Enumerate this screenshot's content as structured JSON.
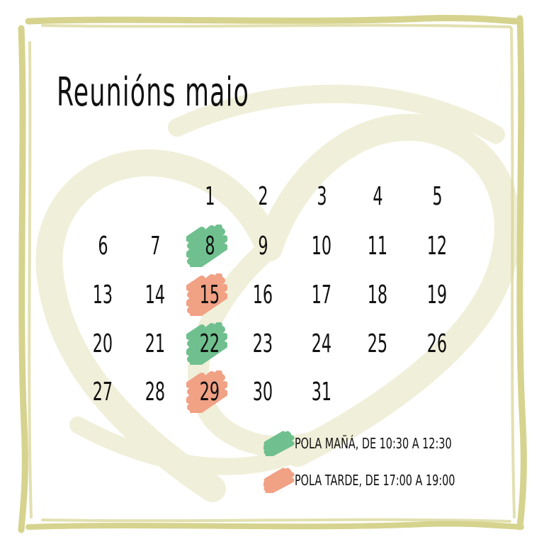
{
  "title": "Reunións maio",
  "colors": {
    "frame": "#d6d38e",
    "watermark": "#f0efd9",
    "morning": "#6fc08e",
    "afternoon": "#f1a184"
  },
  "calendar": {
    "days": [
      {
        "n": "1",
        "col": 2,
        "row": 0
      },
      {
        "n": "2",
        "col": 3,
        "row": 0
      },
      {
        "n": "3",
        "col": 4,
        "row": 0
      },
      {
        "n": "4",
        "col": 5,
        "row": 0
      },
      {
        "n": "5",
        "col": 6,
        "row": 0
      },
      {
        "n": "6",
        "col": 0,
        "row": 1
      },
      {
        "n": "7",
        "col": 1,
        "row": 1
      },
      {
        "n": "8",
        "col": 2,
        "row": 1,
        "mark": "morning"
      },
      {
        "n": "9",
        "col": 3,
        "row": 1
      },
      {
        "n": "10",
        "col": 4,
        "row": 1
      },
      {
        "n": "11",
        "col": 5,
        "row": 1
      },
      {
        "n": "12",
        "col": 6,
        "row": 1
      },
      {
        "n": "13",
        "col": 0,
        "row": 2
      },
      {
        "n": "14",
        "col": 1,
        "row": 2
      },
      {
        "n": "15",
        "col": 2,
        "row": 2,
        "mark": "afternoon"
      },
      {
        "n": "16",
        "col": 3,
        "row": 2
      },
      {
        "n": "17",
        "col": 4,
        "row": 2
      },
      {
        "n": "18",
        "col": 5,
        "row": 2
      },
      {
        "n": "19",
        "col": 6,
        "row": 2
      },
      {
        "n": "20",
        "col": 0,
        "row": 3
      },
      {
        "n": "21",
        "col": 1,
        "row": 3
      },
      {
        "n": "22",
        "col": 2,
        "row": 3,
        "mark": "morning"
      },
      {
        "n": "23",
        "col": 3,
        "row": 3
      },
      {
        "n": "24",
        "col": 4,
        "row": 3
      },
      {
        "n": "25",
        "col": 5,
        "row": 3
      },
      {
        "n": "26",
        "col": 6,
        "row": 3
      },
      {
        "n": "27",
        "col": 0,
        "row": 4
      },
      {
        "n": "28",
        "col": 1,
        "row": 4
      },
      {
        "n": "29",
        "col": 2,
        "row": 4,
        "mark": "afternoon"
      },
      {
        "n": "30",
        "col": 3,
        "row": 4
      },
      {
        "n": "31",
        "col": 4,
        "row": 4
      }
    ]
  },
  "legend": {
    "morning": "pola mañá, de 10:30 a 12:30",
    "afternoon": "pola tarde, de 17:00 a 19:00"
  }
}
